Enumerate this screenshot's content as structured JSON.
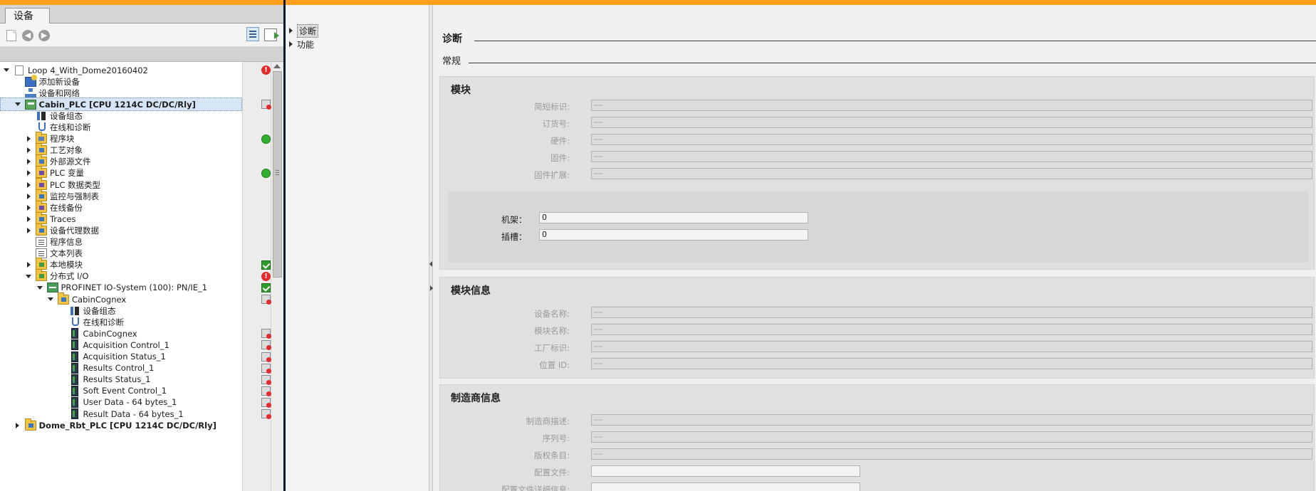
{
  "tab": {
    "label": "设备"
  },
  "tree": {
    "rows": [
      {
        "label": "Loop 4_With_Dome20160402",
        "level": 0,
        "expander": "down",
        "icon": "doc",
        "status": "error"
      },
      {
        "label": "添加新设备",
        "level": 1,
        "expander": "none",
        "icon": "add-device",
        "status": ""
      },
      {
        "label": "设备和网络",
        "level": 1,
        "expander": "none",
        "icon": "network",
        "status": ""
      },
      {
        "label": "Cabin_PLC [CPU 1214C DC/DC/Rly]",
        "level": 1,
        "expander": "down",
        "icon": "plc",
        "status": "offline-check",
        "selected": true,
        "bold": true
      },
      {
        "label": "设备组态",
        "level": 2,
        "expander": "none",
        "icon": "config",
        "status": ""
      },
      {
        "label": "在线和诊断",
        "level": 2,
        "expander": "none",
        "icon": "diag",
        "status": ""
      },
      {
        "label": "程序块",
        "level": 2,
        "expander": "right",
        "icon": "folder-prog",
        "status": "green"
      },
      {
        "label": "工艺对象",
        "level": 2,
        "expander": "right",
        "icon": "folder-blue",
        "status": ""
      },
      {
        "label": "外部源文件",
        "level": 2,
        "expander": "right",
        "icon": "folder-blue",
        "status": ""
      },
      {
        "label": "PLC 变量",
        "level": 2,
        "expander": "right",
        "icon": "folder-plc",
        "status": "green"
      },
      {
        "label": "PLC 数据类型",
        "level": 2,
        "expander": "right",
        "icon": "folder-plc",
        "status": ""
      },
      {
        "label": "监控与强制表",
        "level": 2,
        "expander": "right",
        "icon": "folder-blue",
        "status": ""
      },
      {
        "label": "在线备份",
        "level": 2,
        "expander": "right",
        "icon": "folder-plc",
        "status": ""
      },
      {
        "label": "Traces",
        "level": 2,
        "expander": "right",
        "icon": "folder-blue",
        "status": ""
      },
      {
        "label": "设备代理数据",
        "level": 2,
        "expander": "right",
        "icon": "folder-blue",
        "status": ""
      },
      {
        "label": "程序信息",
        "level": 2,
        "expander": "none",
        "icon": "info",
        "status": ""
      },
      {
        "label": "文本列表",
        "level": 2,
        "expander": "none",
        "icon": "info",
        "status": ""
      },
      {
        "label": "本地模块",
        "level": 2,
        "expander": "right",
        "icon": "folder-green",
        "status": "check"
      },
      {
        "label": "分布式 I/O",
        "level": 2,
        "expander": "down",
        "icon": "folder-green",
        "status": "error"
      },
      {
        "label": "PROFINET IO-System (100): PN/IE_1",
        "level": 3,
        "expander": "down",
        "icon": "profinet",
        "status": "check"
      },
      {
        "label": "CabinCognex",
        "level": 4,
        "expander": "down",
        "icon": "folder-blue",
        "status": "offline"
      },
      {
        "label": "设备组态",
        "level": 5,
        "expander": "none",
        "icon": "config",
        "status": ""
      },
      {
        "label": "在线和诊断",
        "level": 5,
        "expander": "none",
        "icon": "diag",
        "status": ""
      },
      {
        "label": "CabinCognex",
        "level": 5,
        "expander": "none",
        "icon": "module",
        "status": "offline"
      },
      {
        "label": "Acquisition Control_1",
        "level": 5,
        "expander": "none",
        "icon": "module",
        "status": "offline"
      },
      {
        "label": "Acquisition Status_1",
        "level": 5,
        "expander": "none",
        "icon": "module",
        "status": "offline"
      },
      {
        "label": "Results Control_1",
        "level": 5,
        "expander": "none",
        "icon": "module",
        "status": "offline"
      },
      {
        "label": "Results Status_1",
        "level": 5,
        "expander": "none",
        "icon": "module",
        "status": "offline"
      },
      {
        "label": "Soft Event Control_1",
        "level": 5,
        "expander": "none",
        "icon": "module",
        "status": "offline"
      },
      {
        "label": "User Data - 64 bytes_1",
        "level": 5,
        "expander": "none",
        "icon": "module",
        "status": "offline"
      },
      {
        "label": "Result Data - 64 bytes_1",
        "level": 5,
        "expander": "none",
        "icon": "module",
        "status": "offline"
      },
      {
        "label": "Dome_Rbt_PLC [CPU 1214C DC/DC/Rly]",
        "level": 1,
        "expander": "right",
        "icon": "folder-blue",
        "status": "",
        "bold": true
      }
    ]
  },
  "nav": {
    "items": [
      {
        "label": "诊断",
        "selected": true
      },
      {
        "label": "功能",
        "selected": false
      }
    ]
  },
  "content": {
    "title": "诊断",
    "subtitle": "常规",
    "module": {
      "title": "模块",
      "fields": [
        {
          "label": "简短标识:",
          "value": "---"
        },
        {
          "label": "订货号:",
          "value": "---"
        },
        {
          "label": "硬件:",
          "value": "---"
        },
        {
          "label": "固件:",
          "value": "---"
        },
        {
          "label": "固件扩展:",
          "value": "---"
        }
      ],
      "rack_label": "机架：",
      "rack_value": "0",
      "slot_label": "插槽：",
      "slot_value": "0"
    },
    "module_info": {
      "title": "模块信息",
      "fields": [
        {
          "label": "设备名称:",
          "value": "---"
        },
        {
          "label": "模块名称:",
          "value": "---"
        },
        {
          "label": "工厂标识:",
          "value": "---"
        },
        {
          "label": "位置 ID:",
          "value": "---"
        }
      ]
    },
    "manufacturer": {
      "title": "制造商信息",
      "fields": [
        {
          "label": "制造商描述:",
          "value": "---"
        },
        {
          "label": "序列号:",
          "value": "---"
        },
        {
          "label": "版权条目:",
          "value": "---"
        },
        {
          "label": "配置文件:",
          "value": ""
        },
        {
          "label": "配置文件详细信息:",
          "value": ""
        }
      ]
    }
  }
}
